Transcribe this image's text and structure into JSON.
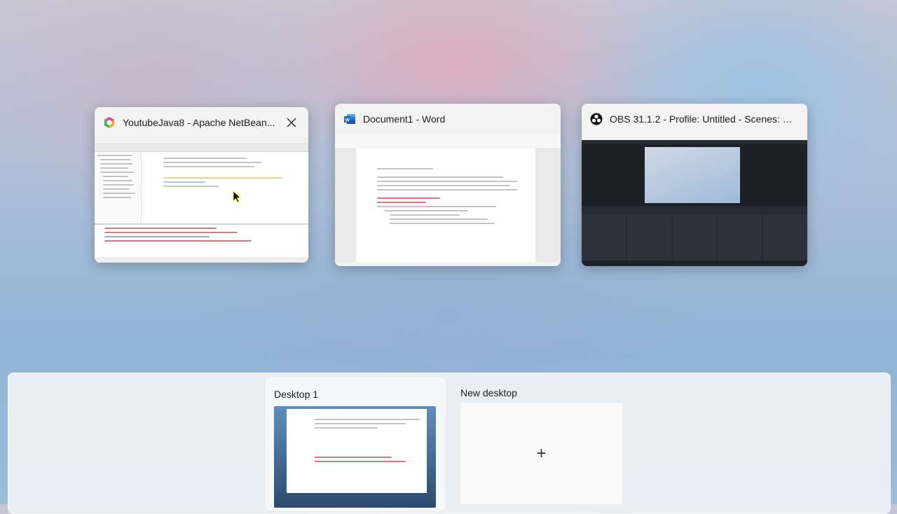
{
  "windows": [
    {
      "title": "YoutubeJava8 - Apache NetBean...",
      "app_icon": "netbeans-icon",
      "close_icon": "close-icon"
    },
    {
      "title": "Document1 - Word",
      "app_icon": "word-icon"
    },
    {
      "title": "OBS 31.1.2 - Profile: Untitled - Scenes: Un...",
      "app_icon": "obs-icon"
    }
  ],
  "desktops": {
    "items": [
      {
        "label": "Desktop 1"
      }
    ],
    "new_desktop_label": "New desktop",
    "add_symbol": "+"
  },
  "colors": {
    "word_blue": "#185abd",
    "netbeans_accent": "#7b3fb2",
    "obs_dark": "#272a33"
  }
}
